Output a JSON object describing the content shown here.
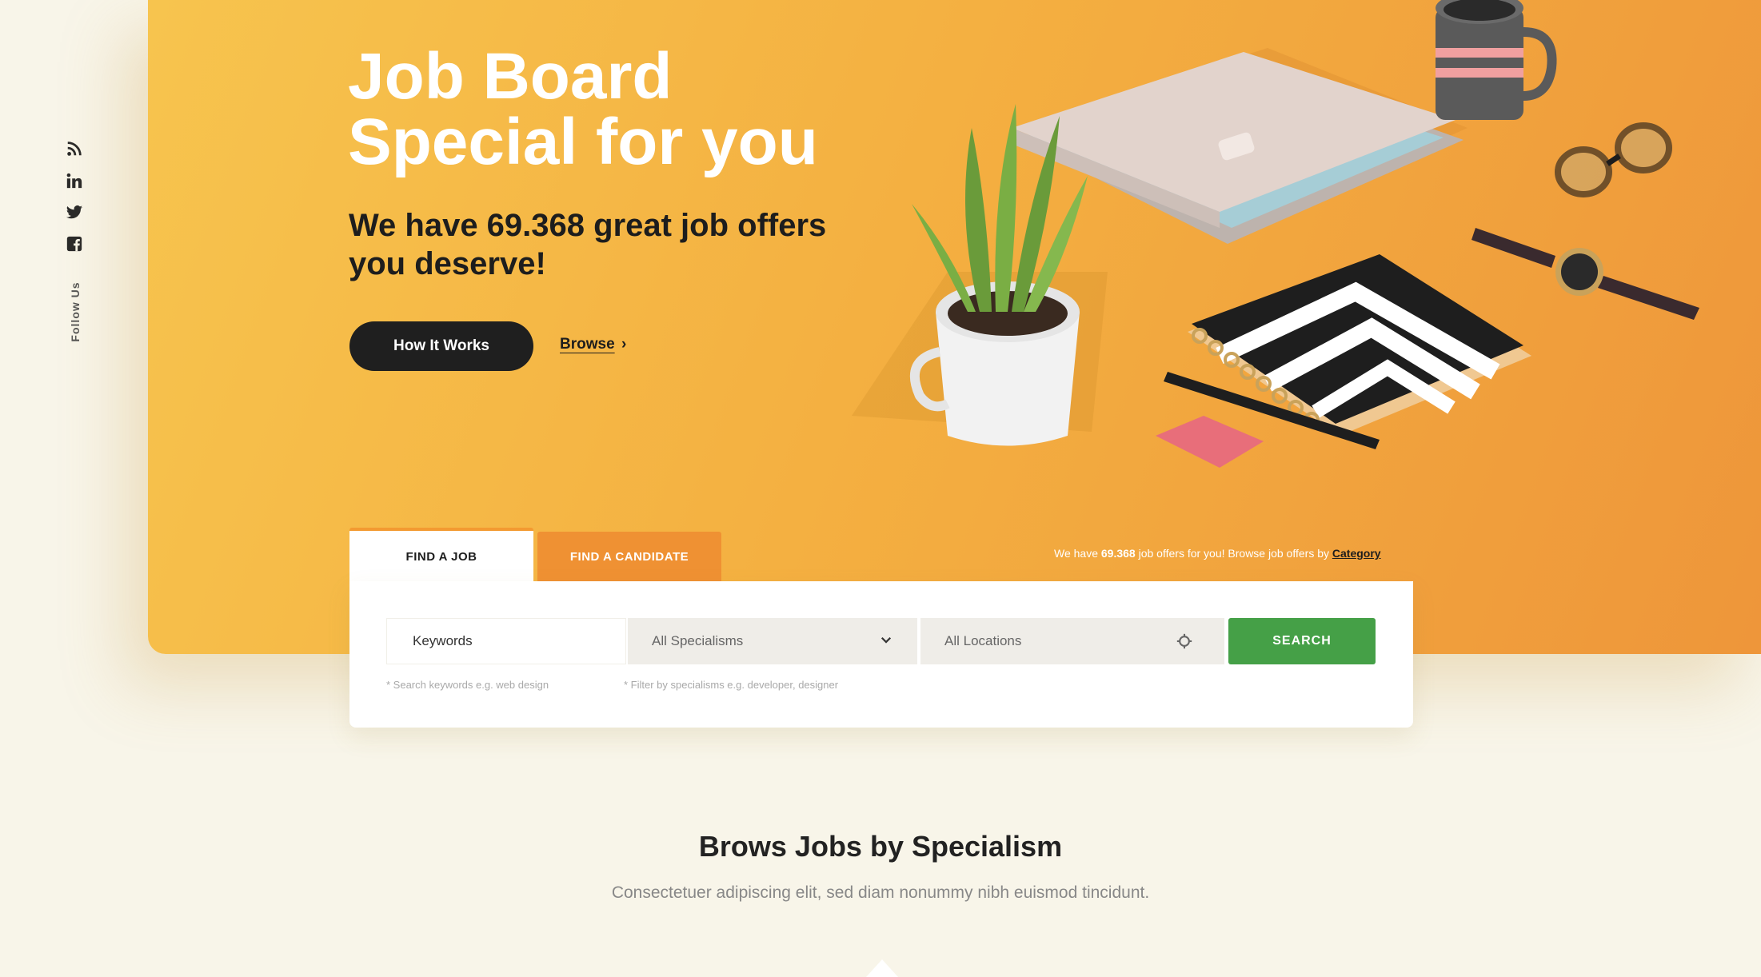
{
  "sidebar": {
    "follow_label": "Follow Us",
    "icons": [
      "rss-icon",
      "linkedin-icon",
      "twitter-icon",
      "facebook-icon"
    ]
  },
  "hero": {
    "title_line1": "Job Board",
    "title_line2": "Special for you",
    "subtitle": "We have 69.368 great job offers you deserve!",
    "how_it_works_label": "How It Works",
    "browse_label": "Browse",
    "browse_arrow": "›",
    "gradient_colors": [
      "#f7c44e",
      "#f4b041",
      "#ee963a"
    ]
  },
  "search": {
    "tabs": [
      {
        "label": "FIND A JOB",
        "active": true
      },
      {
        "label": "FIND A CANDIDATE",
        "active": false
      }
    ],
    "offers_note_prefix": "We have ",
    "offers_note_count": "69.368",
    "offers_note_middle": " job offers for you! Browse job offers by ",
    "offers_note_link": "Category",
    "keywords_placeholder": "Keywords",
    "specialism_value": "All Specialisms",
    "location_value": "All Locations",
    "search_label": "SEARCH",
    "keywords_hint": "* Search keywords e.g. web design",
    "specialism_hint": "* Filter by specialisms e.g. developer, designer",
    "accent_color": "#ef9133",
    "search_color": "#45a047"
  },
  "section": {
    "title": "Brows Jobs by Specialism",
    "subtitle": "Consectetuer adipiscing elit, sed diam nonummy nibh euismod tincidunt."
  }
}
